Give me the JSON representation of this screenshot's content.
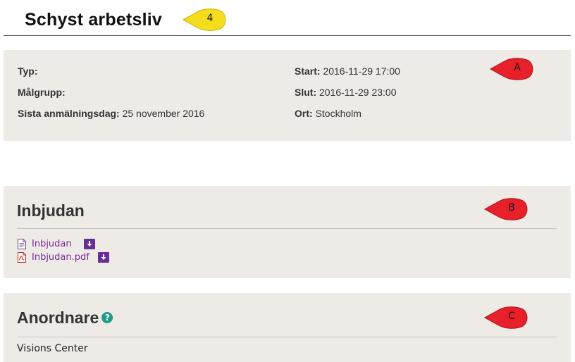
{
  "page": {
    "title": "Schyst arbetsliv"
  },
  "callouts": {
    "step": "4",
    "a": "A",
    "b": "B",
    "c": "C"
  },
  "info": {
    "type_label": "Typ:",
    "type_value": "",
    "target_label": "Målgrupp:",
    "target_value": "",
    "deadline_label": "Sista anmälningsdag:",
    "deadline_value": "25 november 2016",
    "start_label": "Start:",
    "start_value": "2016-11-29 17:00",
    "end_label": "Slut:",
    "end_value": "2016-11-29 23:00",
    "location_label": "Ort:",
    "location_value": "Stockholm"
  },
  "invite": {
    "title": "Inbjudan",
    "files": [
      {
        "name": "Inbjudan",
        "icon": "document-icon"
      },
      {
        "name": "Inbjudan.pdf",
        "icon": "pdf-icon"
      }
    ]
  },
  "organizer": {
    "title": "Anordnare",
    "help_icon": "?",
    "name": "Visions Center"
  },
  "colors": {
    "panel_bg": "#eeebe6",
    "link": "#7a2a9a",
    "download_btn": "#6a2c9a",
    "help_icon": "#1f9d88",
    "callout_yellow": "#f5dc1c",
    "callout_red": "#e8202a"
  }
}
